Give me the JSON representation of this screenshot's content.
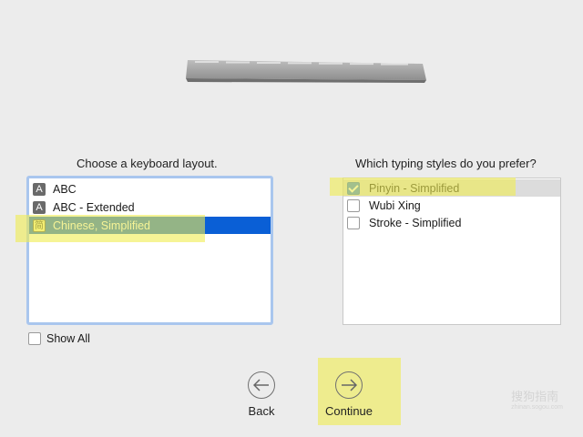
{
  "layout_prompt": "Choose a keyboard layout.",
  "style_prompt": "Which typing styles do you prefer?",
  "layouts": [
    {
      "badge": "A",
      "label": "ABC"
    },
    {
      "badge": "A",
      "label": "ABC - Extended"
    },
    {
      "badge": "简",
      "label": "Chinese, Simplified",
      "selected": true
    }
  ],
  "typing_styles": [
    {
      "label": "Pinyin - Simplified",
      "checked": true
    },
    {
      "label": "Wubi Xing",
      "checked": false
    },
    {
      "label": "Stroke - Simplified",
      "checked": false
    }
  ],
  "show_all_label": "Show All",
  "back_label": "Back",
  "continue_label": "Continue",
  "watermark": "搜狗指南",
  "watermark_url": "zhinan.sogou.com",
  "colors": {
    "selection": "#0a5fd6",
    "highlight": "#f0ec50",
    "focus_ring": "#a9c6ee"
  }
}
